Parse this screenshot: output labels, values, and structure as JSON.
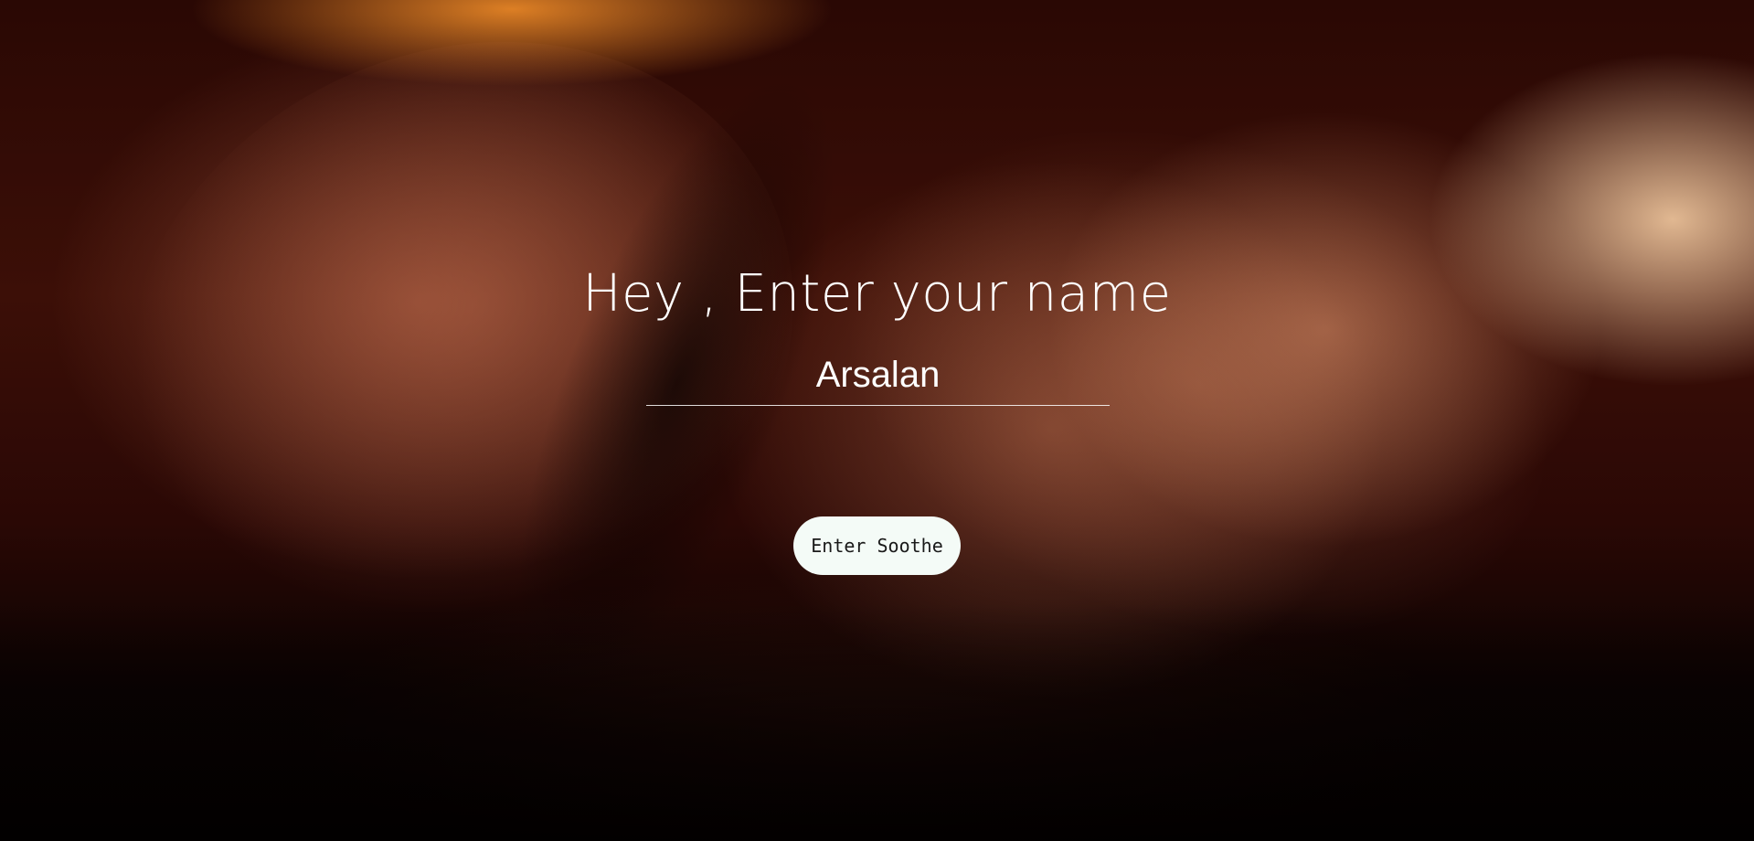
{
  "heading": {
    "text": "Hey , Enter your name"
  },
  "name_input": {
    "value": "Arsalan",
    "placeholder": ""
  },
  "button": {
    "label": "Enter Soothe"
  },
  "colors": {
    "text": "#ffffff",
    "button_bg": "#f4fbf7",
    "button_text": "#1a1a1a"
  }
}
